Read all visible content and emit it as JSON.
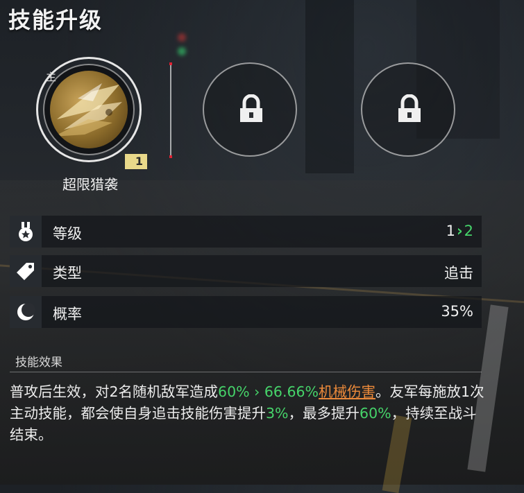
{
  "title": "技能升级",
  "main_skill": {
    "tag": "主",
    "name": "超限猎袭",
    "level": "1"
  },
  "locked_slots": [
    {
      "icon": "lock-icon"
    },
    {
      "icon": "lock-icon"
    }
  ],
  "stats": [
    {
      "icon": "medal-icon",
      "label": "等级",
      "value": "1",
      "next": "2"
    },
    {
      "icon": "tag-icon",
      "label": "类型",
      "value": "追击"
    },
    {
      "icon": "moon-icon",
      "label": "概率",
      "value": "35%"
    }
  ],
  "effects": {
    "title": "技能效果",
    "p1": "普攻后生效，对2名随机敌军造成",
    "v1": "60%",
    "v2": "66.66%",
    "dmg": "机械伤害",
    "p2": "。友军每施放1次主动技能，都会使自身追击技能伤害提升",
    "v3": "3%",
    "p3": "，最多提升",
    "v4": "60%",
    "p4": "，持续至战斗结束。"
  },
  "colors": {
    "accent_green": "#46d46a",
    "damage_orange": "#ec8a3a",
    "badge_yellow": "#e9d98a"
  }
}
